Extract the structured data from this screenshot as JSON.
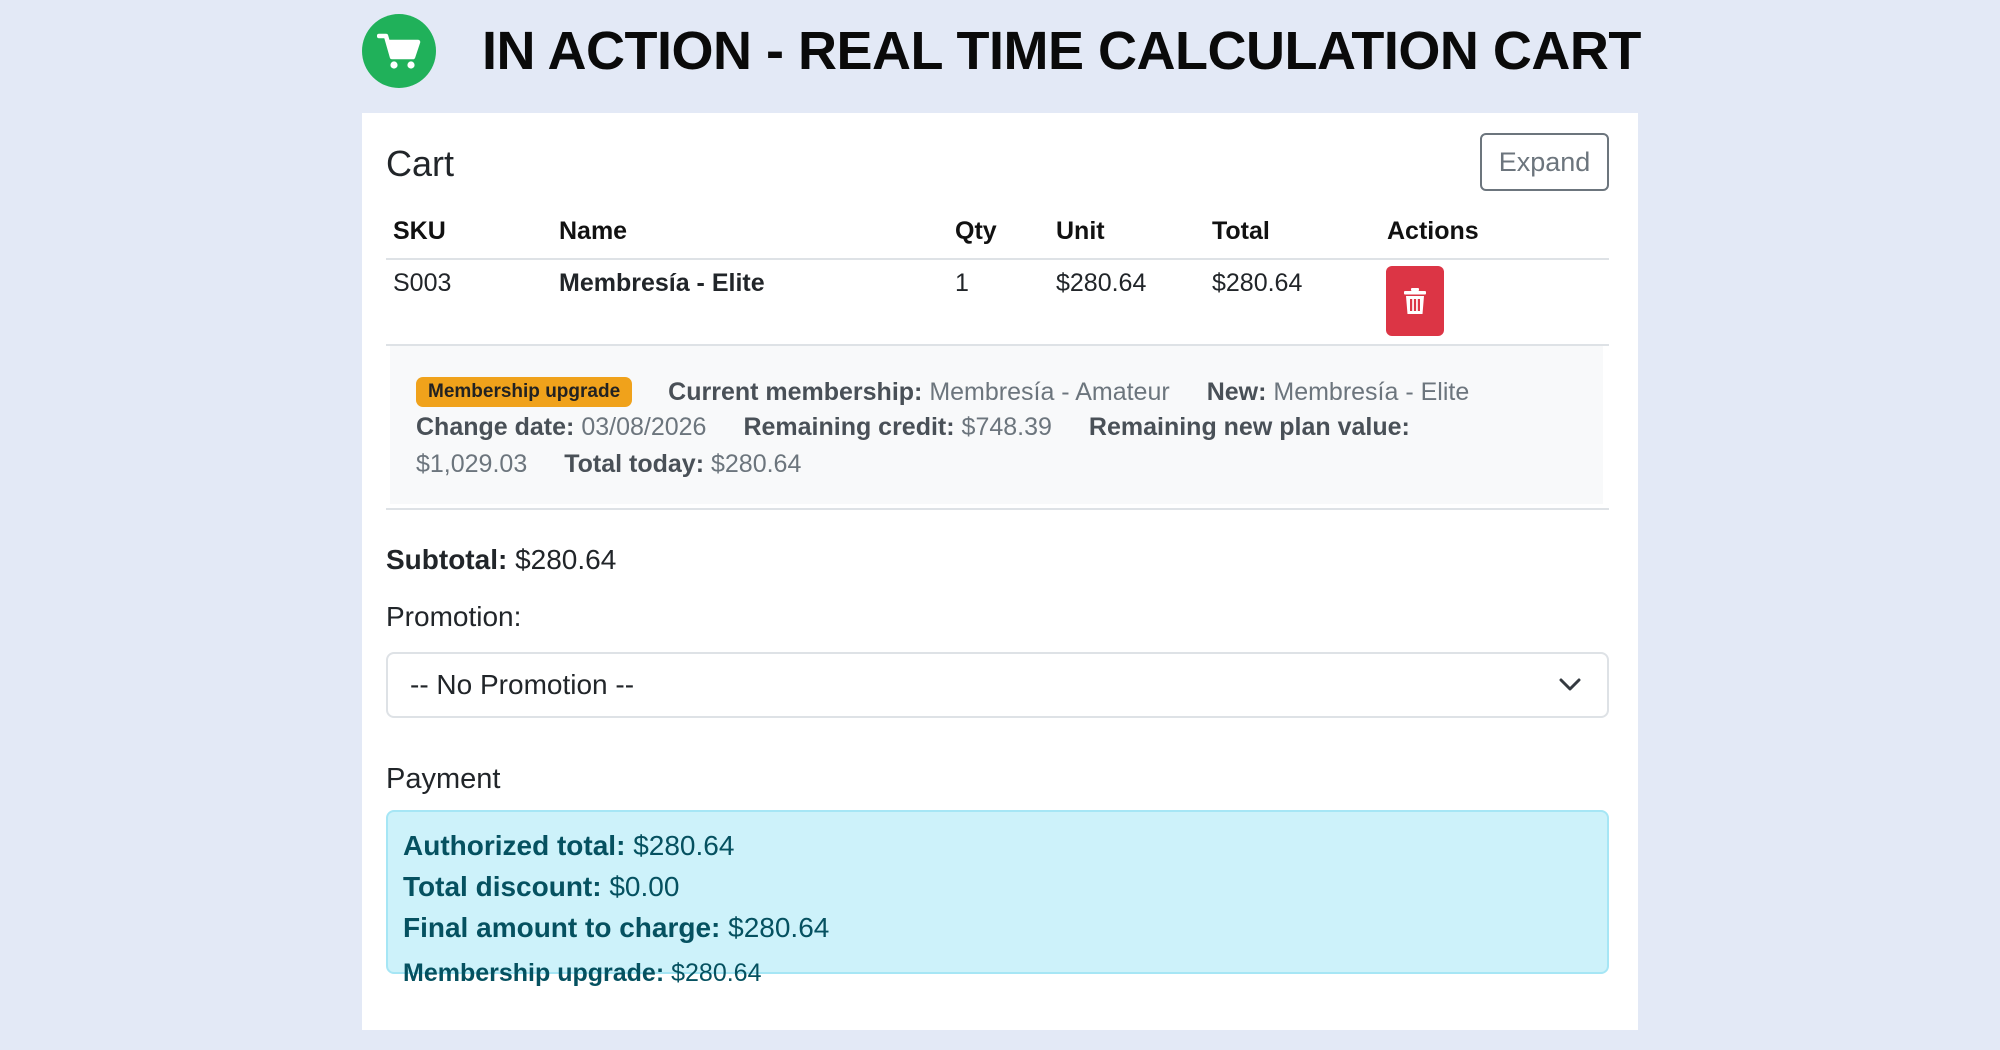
{
  "banner": {
    "icon": "shopping-cart-icon",
    "title": "IN ACTION - REAL TIME CALCULATION CART"
  },
  "cart": {
    "title": "Cart",
    "expand_label": "Expand",
    "columns": [
      "SKU",
      "Name",
      "Qty",
      "Unit",
      "Total",
      "Actions"
    ],
    "rows": [
      {
        "sku": "S003",
        "name": "Membresía - Elite",
        "qty": "1",
        "unit": "$280.64",
        "total": "$280.64",
        "action_icon": "trash-icon"
      }
    ],
    "upgrade": {
      "badge": "Membership upgrade",
      "current_label": "Current membership:",
      "current_value": "Membresía - Amateur",
      "new_label": "New:",
      "new_value": "Membresía - Elite",
      "change_date_label": "Change date:",
      "change_date_value": "03/08/2026",
      "remaining_credit_label": "Remaining credit:",
      "remaining_credit_value": "$748.39",
      "remaining_new_label": "Remaining new plan value:",
      "remaining_new_value": "$1,029.03",
      "total_today_label": "Total today:",
      "total_today_value": "$280.64"
    }
  },
  "subtotal": {
    "label": "Subtotal:",
    "value": "$280.64"
  },
  "promotion": {
    "label": "Promotion:",
    "selected": "-- No Promotion --"
  },
  "payment": {
    "title": "Payment",
    "authorized_label": "Authorized total:",
    "authorized_value": "$280.64",
    "discount_label": "Total discount:",
    "discount_value": "$0.00",
    "final_label": "Final amount to charge:",
    "final_value": "$280.64",
    "upgrade_label": "Membership upgrade:",
    "upgrade_value": "$280.64"
  },
  "colors": {
    "background": "#e3e9f6",
    "logo": "#20b15a",
    "danger": "#dc3545",
    "badge": "#f0a21b",
    "info_bg": "#cdf2fa",
    "info_text": "#055160"
  }
}
